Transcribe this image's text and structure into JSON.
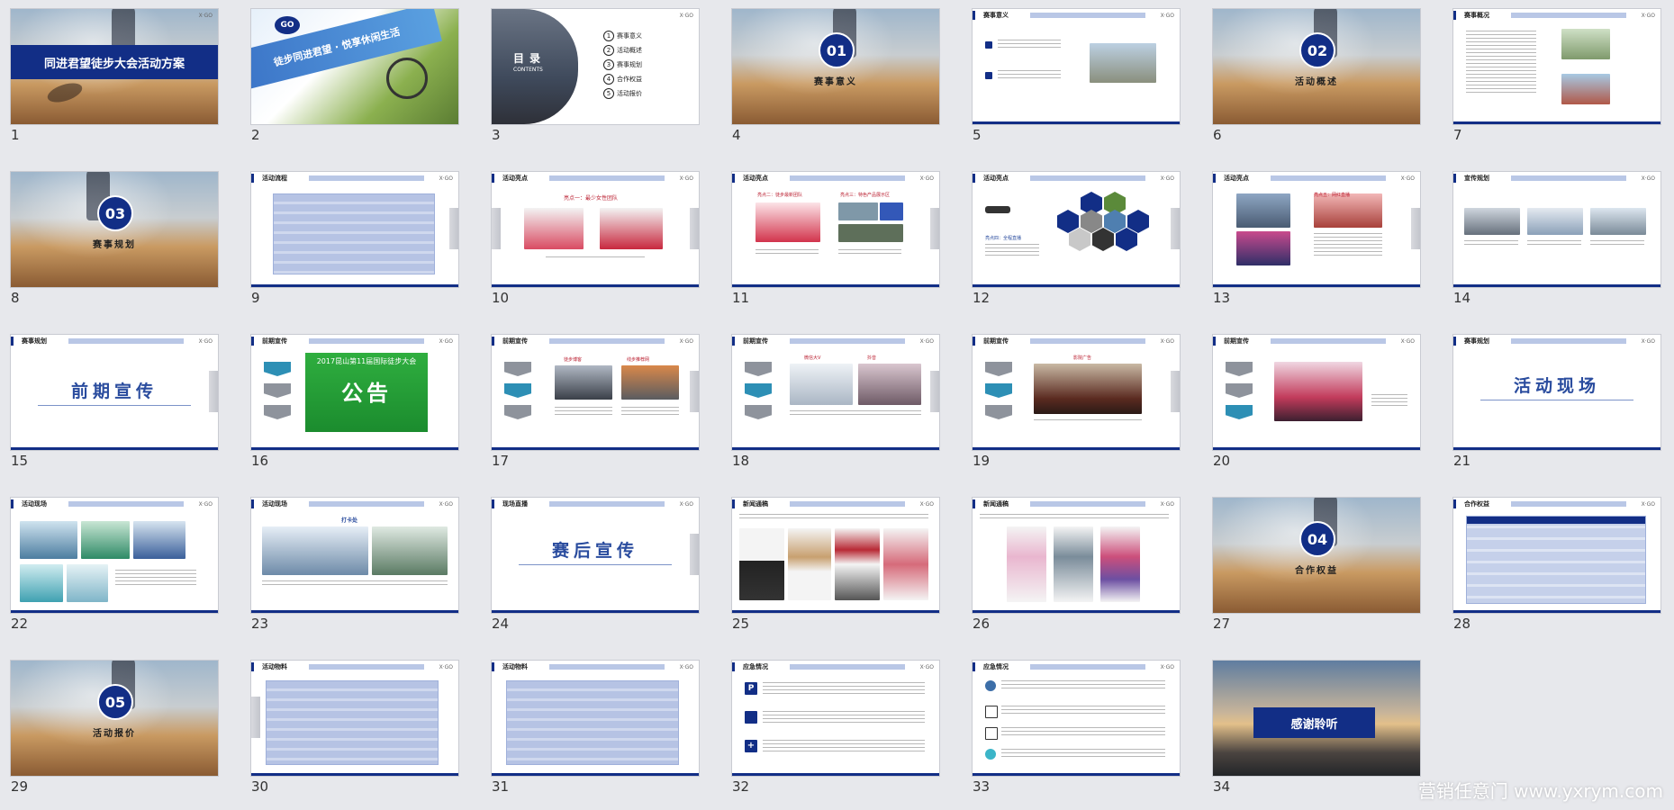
{
  "slides": [
    {
      "n": "1",
      "title": "同进君望徒步大会活动方案"
    },
    {
      "n": "2",
      "badge": "GO",
      "tagline": "徒步同进君望 · 悦享休闲生活"
    },
    {
      "n": "3",
      "toc_title": "目录",
      "toc_sub": "CONTENTS",
      "toc_items": [
        "赛事意义",
        "活动概述",
        "赛事规划",
        "合作权益",
        "活动报价"
      ]
    },
    {
      "n": "4",
      "circle": "01",
      "label": "赛事意义"
    },
    {
      "n": "5",
      "header": "赛事意义"
    },
    {
      "n": "6",
      "circle": "02",
      "label": "活动概述"
    },
    {
      "n": "7",
      "header": "赛事概况"
    },
    {
      "n": "8",
      "circle": "03",
      "label": "赛事规划"
    },
    {
      "n": "9",
      "header": "活动流程"
    },
    {
      "n": "10",
      "header": "活动亮点",
      "sub": "亮点一：最少女性团队"
    },
    {
      "n": "11",
      "header": "活动亮点",
      "sub": "亮点二：徒步最新团队",
      "sub2": "亮点三：特色产品展示区"
    },
    {
      "n": "12",
      "header": "活动亮点",
      "sub": "亮点四：全程直播"
    },
    {
      "n": "13",
      "header": "活动亮点",
      "sub": "亮点五：网红直播"
    },
    {
      "n": "14",
      "header": "宣传规划"
    },
    {
      "n": "15",
      "header": "赛事规划",
      "big": "前期宣传"
    },
    {
      "n": "16",
      "header": "前期宣传",
      "poster_year": "2017昆山第11届国际徒步大会",
      "poster_big": "公告"
    },
    {
      "n": "17",
      "header": "前期宣传",
      "sub": "徒步博客",
      "sub2": "线步推荐网"
    },
    {
      "n": "18",
      "header": "前期宣传",
      "sub": "微信大V",
      "sub2": "抖音"
    },
    {
      "n": "19",
      "header": "前期宣传",
      "sub": "影院广告"
    },
    {
      "n": "20",
      "header": "前期宣传"
    },
    {
      "n": "21",
      "header": "赛事规划",
      "big": "活动现场"
    },
    {
      "n": "22",
      "header": "活动现场"
    },
    {
      "n": "23",
      "header": "活动现场",
      "sub": "打卡处"
    },
    {
      "n": "24",
      "header": "现场直播",
      "big": "赛后宣传"
    },
    {
      "n": "25",
      "header": "新闻通稿"
    },
    {
      "n": "26",
      "header": "新闻通稿"
    },
    {
      "n": "27",
      "circle": "04",
      "label": "合作权益"
    },
    {
      "n": "28",
      "header": "合作权益"
    },
    {
      "n": "29",
      "circle": "05",
      "label": "活动报价"
    },
    {
      "n": "30",
      "header": "活动物料"
    },
    {
      "n": "31",
      "header": "活动物料"
    },
    {
      "n": "32",
      "header": "应急情况"
    },
    {
      "n": "33",
      "header": "应急情况"
    },
    {
      "n": "34",
      "title": "感谢聆听"
    }
  ],
  "brand": {
    "corner": "X·GO"
  },
  "watermark": "营销任意门 www.yxrym.com",
  "colors": {
    "navy": "#122e86",
    "strip": "#b9c7e6",
    "bg": "#e7e8ec"
  }
}
